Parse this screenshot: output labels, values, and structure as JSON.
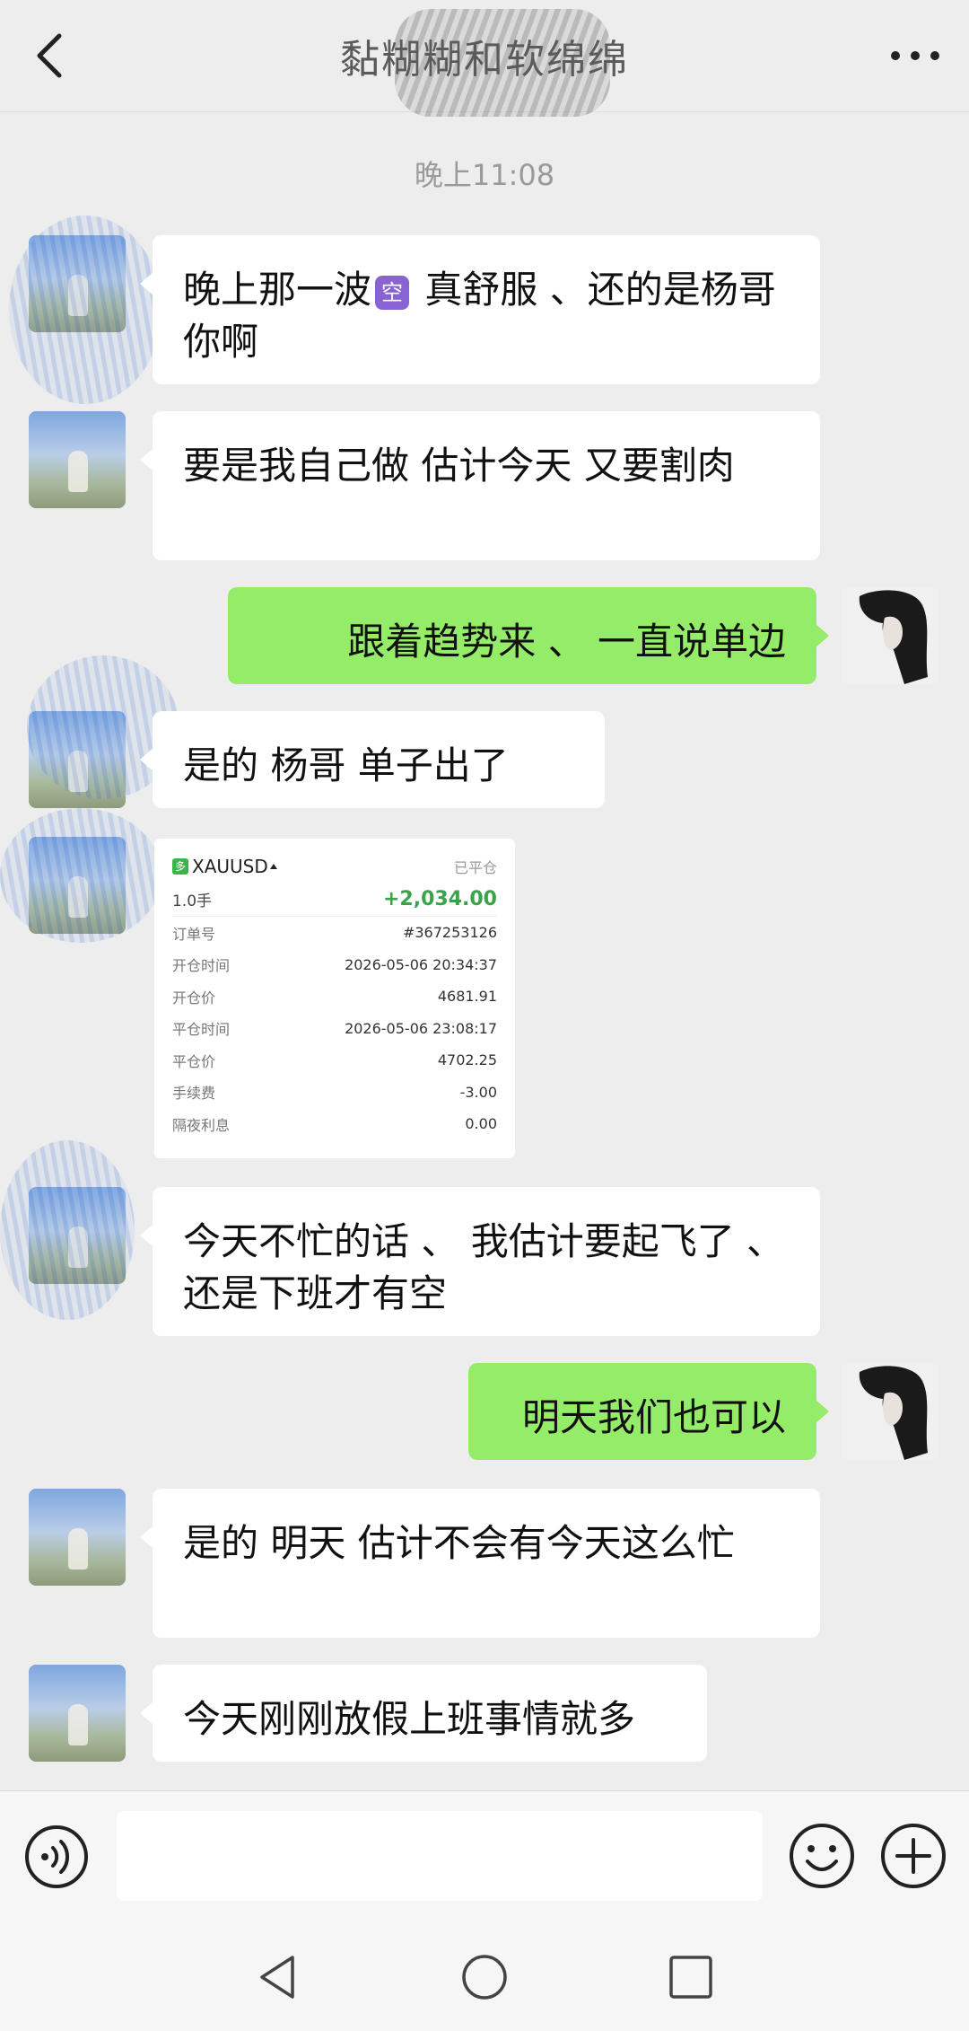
{
  "header": {
    "title": "黏糊糊和软绵绵",
    "back_icon": "chevron-left-icon",
    "more_icon": "more-dots-icon"
  },
  "timestamp": "晚上11:08",
  "messages": [
    {
      "side": "in",
      "text_before": "晚上那一波",
      "emoji": "空",
      "text_after": " 真舒服 、还的是杨哥你啊"
    },
    {
      "side": "in",
      "text": "要是我自己做 估计今天 又要割肉"
    },
    {
      "side": "out",
      "text": "跟着趋势来 、 一直说单边"
    },
    {
      "side": "in",
      "text": "是的 杨哥 单子出了"
    },
    {
      "side": "in",
      "text": "今天不忙的话 、 我估计要起飞了 、 还是下班才有空"
    },
    {
      "side": "out",
      "text": "明天我们也可以"
    },
    {
      "side": "in",
      "text": "是的 明天 估计不会有今天这么忙"
    },
    {
      "side": "in",
      "text": "今天刚刚放假上班事情就多"
    }
  ],
  "trade_card": {
    "logo": "多",
    "symbol": "XAUUSD",
    "status": "已平仓",
    "lots": "1.0手",
    "profit": "+2,034.00",
    "rows": [
      {
        "label": "订单号",
        "value": "#367253126"
      },
      {
        "label": "开仓时间",
        "value": "2026-05-06 20:34:37"
      },
      {
        "label": "开仓价",
        "value": "4681.91"
      },
      {
        "label": "平仓时间",
        "value": "2026-05-06 23:08:17"
      },
      {
        "label": "平仓价",
        "value": "4702.25"
      },
      {
        "label": "手续费",
        "value": "-3.00"
      },
      {
        "label": "隔夜利息",
        "value": "0.00"
      }
    ]
  },
  "input_bar": {
    "placeholder": "",
    "voice_icon": "voice-icon",
    "emoji_icon": "smiley-icon",
    "plus_icon": "plus-icon"
  },
  "nav_bar": {
    "back_icon": "nav-back-icon",
    "home_icon": "nav-home-icon",
    "recents_icon": "nav-recents-icon"
  },
  "colors": {
    "background": "#ededed",
    "bubble_in": "#ffffff",
    "bubble_out": "#95ec69",
    "profit": "#3aa34a"
  }
}
